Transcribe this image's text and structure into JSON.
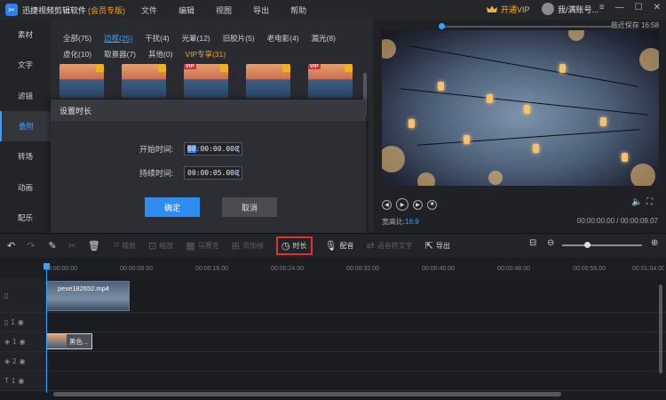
{
  "titlebar": {
    "app_title": "迅捷视频剪辑软件",
    "edition": "(会员专版)",
    "menu": [
      "文件",
      "编辑",
      "视图",
      "导出",
      "帮助"
    ],
    "vip": "开通VIP",
    "account": "我/满账号..."
  },
  "sidebar": {
    "items": [
      {
        "label": "素材"
      },
      {
        "label": "文字"
      },
      {
        "label": "滤镜"
      },
      {
        "label": "叠附"
      },
      {
        "label": "转场"
      },
      {
        "label": "动画"
      },
      {
        "label": "配乐"
      }
    ]
  },
  "panel": {
    "categories": [
      {
        "label": "全部(75)"
      },
      {
        "label": "边框(25)"
      },
      {
        "label": "干扰(4)"
      },
      {
        "label": "光晕(12)"
      },
      {
        "label": "旧胶片(5)"
      },
      {
        "label": "老电影(4)"
      },
      {
        "label": "漏光(8)"
      },
      {
        "label": "虚化(10)"
      },
      {
        "label": "取景器(7)"
      },
      {
        "label": "其他(0)"
      },
      {
        "label": "VIP专享(31)"
      }
    ],
    "thumbnails": [
      {
        "badge": ""
      },
      {
        "badge": ""
      },
      {
        "badge": "VIP"
      },
      {
        "badge": ""
      },
      {
        "badge": "VIP"
      }
    ]
  },
  "dialog": {
    "title": "设置时长",
    "start_label": "开始时间:",
    "start_hh": "00",
    "start_rest": ":00:00.000",
    "duration_label": "持续时间:",
    "duration_value": "00:00:05.000",
    "ok": "确定",
    "cancel": "取消"
  },
  "preview": {
    "autosave": "最近保存 16:58",
    "ratio_label": "宽高比:",
    "ratio_value": "16:9",
    "timecode": "00:00:00.00 / 00:00:09.07"
  },
  "toolbar": {
    "items": [
      {
        "label": "裁剪"
      },
      {
        "label": "缩放"
      },
      {
        "label": "马赛克"
      },
      {
        "label": "添加帧"
      },
      {
        "label": "时长"
      },
      {
        "label": "配音"
      },
      {
        "label": "语音转文字"
      },
      {
        "label": "导出"
      }
    ]
  },
  "ruler": {
    "ticks": [
      "00:00:00.00",
      "00:00:08.00",
      "00:00:16.00",
      "00:00:24.00",
      "00:00:32.00",
      "00:00:40.00",
      "00:00:48.00",
      "00:00:56.00",
      "00:01:04.00"
    ]
  },
  "tracks": {
    "video_clip": "pexe182652.mp4",
    "overlay_clip": "黑色...",
    "row_numbers": [
      "1",
      "1",
      "2",
      "1"
    ]
  }
}
